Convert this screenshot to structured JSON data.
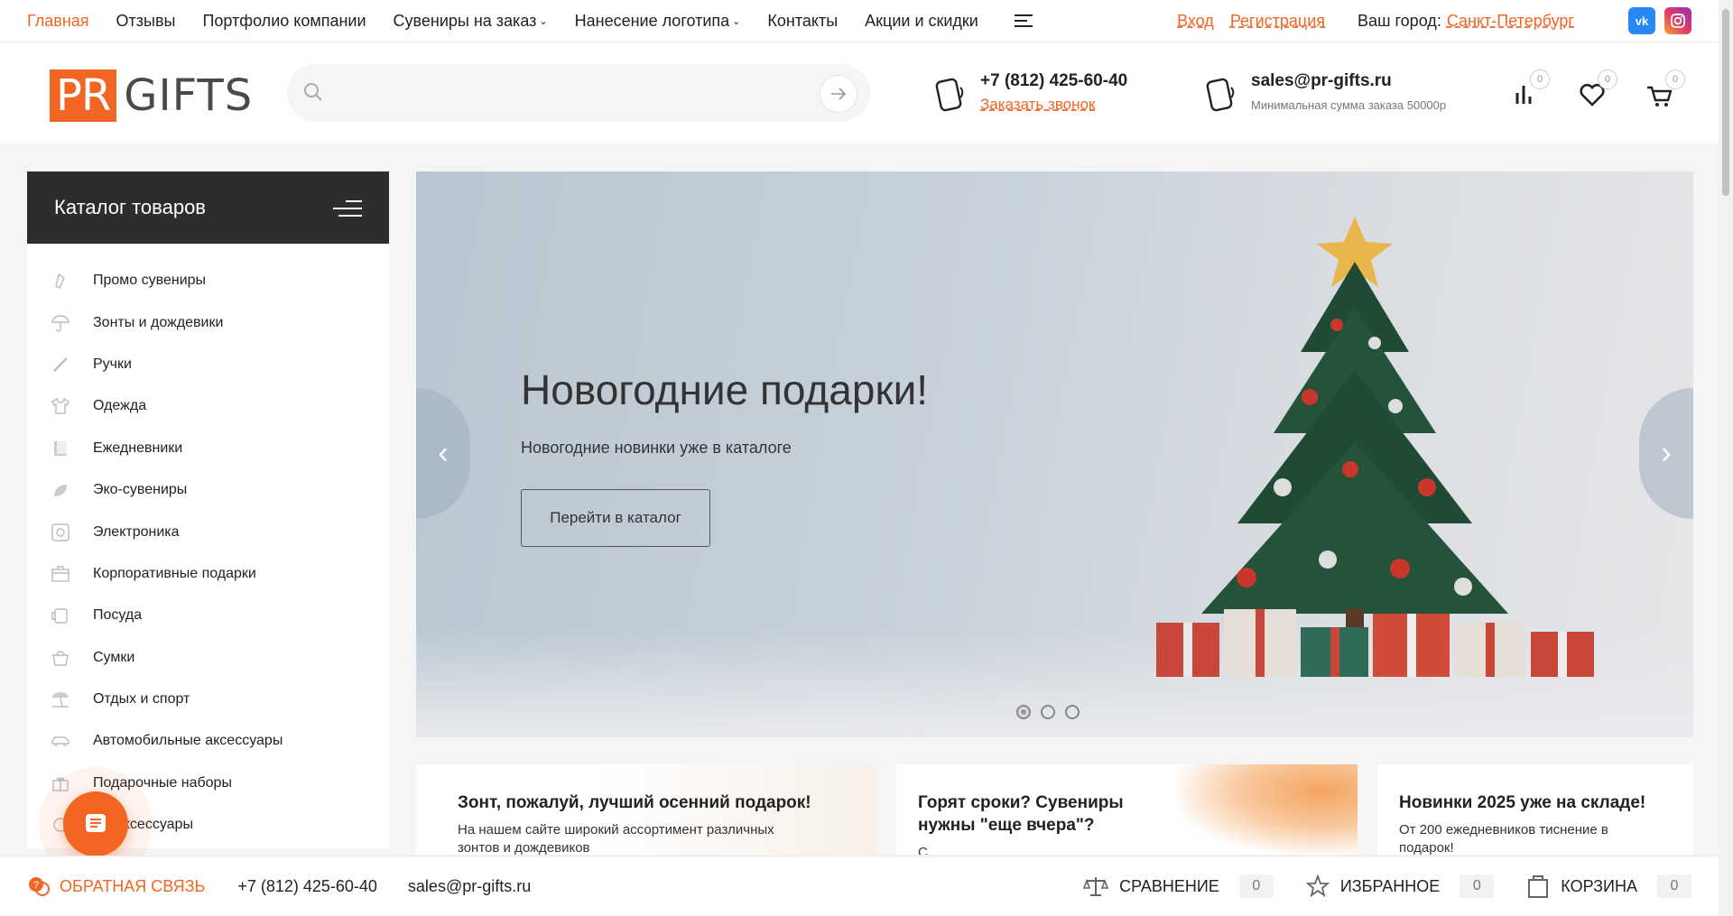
{
  "topnav": {
    "items": [
      {
        "label": "Главная"
      },
      {
        "label": "Отзывы"
      },
      {
        "label": "Портфолио компании"
      },
      {
        "label": "Сувениры на заказ"
      },
      {
        "label": "Нанесение логотипа"
      },
      {
        "label": "Контакты"
      },
      {
        "label": "Акции и скидки"
      }
    ],
    "login": "Вход",
    "register": "Регистрация",
    "city_label": "Ваш город:",
    "city": "Санкт-Петербург",
    "vk": "vk",
    "accent": "#f26522"
  },
  "logo": {
    "pr": "PR",
    "gifts": "GIFTS"
  },
  "search": {
    "placeholder": ""
  },
  "contacts": {
    "phone": "+7 (812) 425-60-40",
    "callback": "Заказать звонок",
    "email": "sales@pr-gifts.ru",
    "min_order": "Минимальная сумма заказа 50000р"
  },
  "header_counters": {
    "compare": "0",
    "favorites": "0",
    "cart": "0"
  },
  "catalog": {
    "title": "Каталог товаров",
    "items": [
      {
        "label": "Промо сувениры",
        "icon": "promo-icon"
      },
      {
        "label": "Зонты и дождевики",
        "icon": "umbrella-icon"
      },
      {
        "label": "Ручки",
        "icon": "pen-icon"
      },
      {
        "label": "Одежда",
        "icon": "tshirt-icon"
      },
      {
        "label": "Ежедневники",
        "icon": "notebook-icon"
      },
      {
        "label": "Эко-сувениры",
        "icon": "leaf-icon"
      },
      {
        "label": "Электроника",
        "icon": "electronics-icon"
      },
      {
        "label": "Корпоративные подарки",
        "icon": "briefcase-icon"
      },
      {
        "label": "Посуда",
        "icon": "mug-icon"
      },
      {
        "label": "Сумки",
        "icon": "bag-icon"
      },
      {
        "label": "Отдых и спорт",
        "icon": "beach-icon"
      },
      {
        "label": "Автомобильные аксессуары",
        "icon": "car-icon"
      },
      {
        "label": "Подарочные наборы",
        "icon": "gift-icon"
      },
      {
        "label": "ые аксессуары",
        "icon": "accessory-icon"
      }
    ]
  },
  "banner": {
    "title": "Новогодние подарки!",
    "subtitle": "Новогодние новинки уже в каталоге",
    "button": "Перейти в каталог",
    "slides": 3,
    "active_slide": 1
  },
  "cards": [
    {
      "title": "Зонт, пожалуй, лучший осенний подарок!",
      "text": "На нашем сайте широкий ассортимент различных зонтов и дождевиков"
    },
    {
      "title": "Горят сроки? Сувениры нужны \"еще вчера\"?",
      "text": "С"
    },
    {
      "title": "Новинки 2025 уже на складе!",
      "text": "От 200 ежедневников тиснение в подарок!"
    }
  ],
  "bottom": {
    "feedback": "ОБРАТНАЯ СВЯЗЬ",
    "phone": "+7 (812) 425-60-40",
    "email": "sales@pr-gifts.ru",
    "compare_label": "СРАВНЕНИЕ",
    "compare_count": "0",
    "favorites_label": "ИЗБРАННОЕ",
    "favorites_count": "0",
    "cart_label": "КОРЗИНА",
    "cart_count": "0"
  }
}
